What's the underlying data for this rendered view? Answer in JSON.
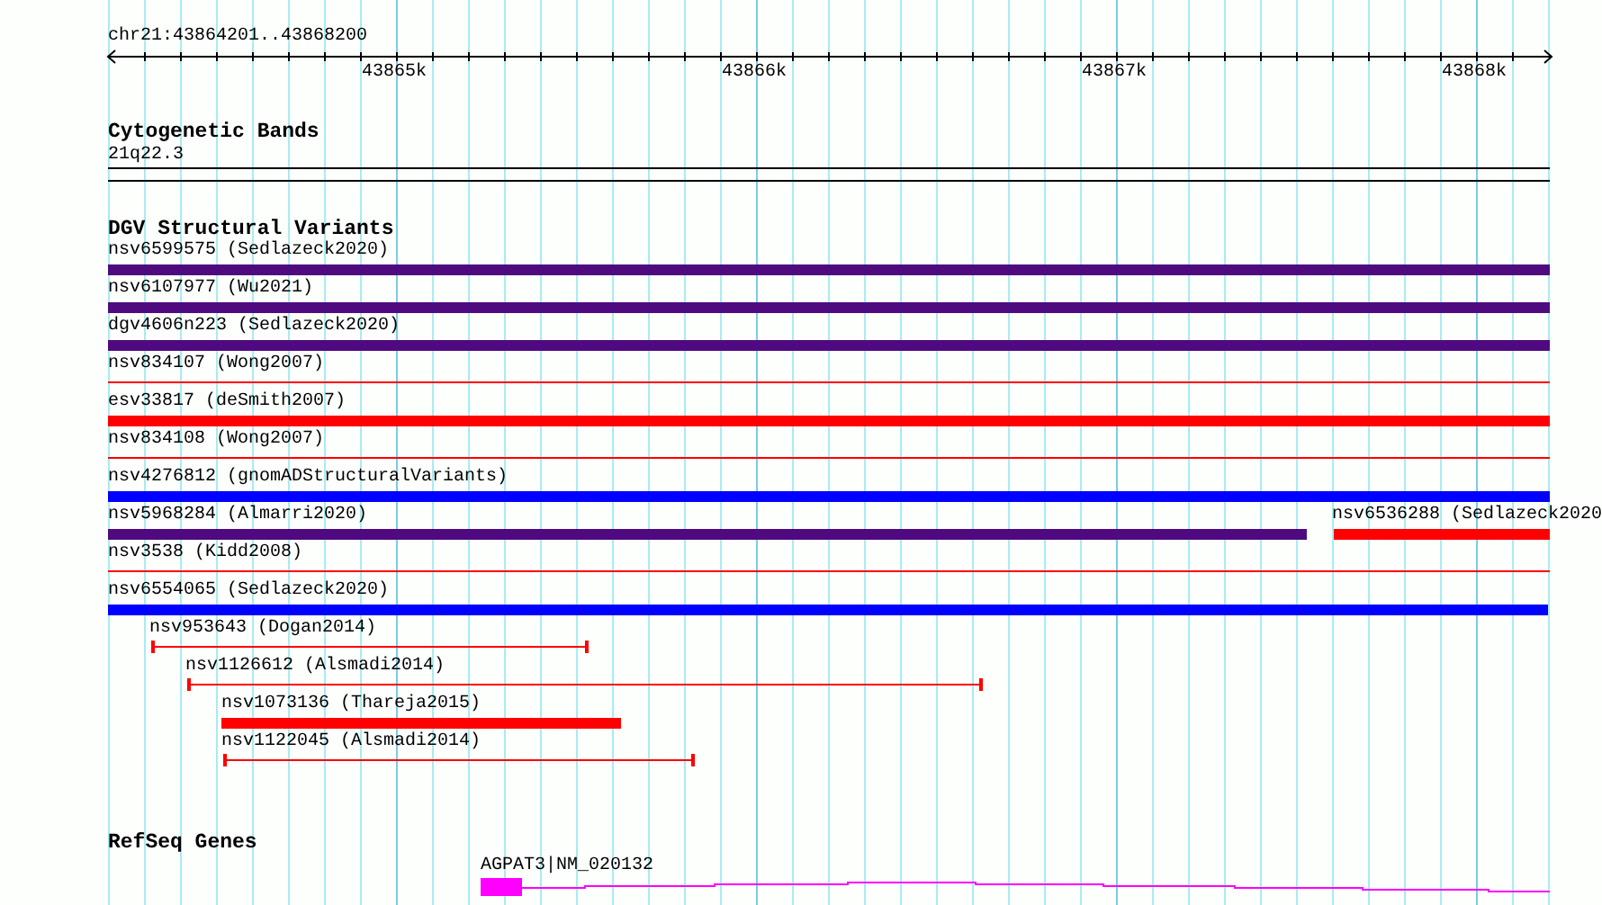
{
  "ruler": {
    "location": "chr21:43864201..43868200",
    "ticks": [
      "43865k",
      "43866k",
      "43867k",
      "43868k"
    ]
  },
  "cytoband_track": {
    "title": "Cytogenetic Bands",
    "band": "21q22.3"
  },
  "dgv_track": {
    "title": "DGV Structural Variants",
    "features": [
      {
        "label": "nsv6599575 (Sedlazeck2020)",
        "kind": "thick",
        "color": "#500a80"
      },
      {
        "label": "nsv6107977 (Wu2021)",
        "kind": "thick",
        "color": "#500a80"
      },
      {
        "label": "dgv4606n223 (Sedlazeck2020)",
        "kind": "thick",
        "color": "#500a80"
      },
      {
        "label": "nsv834107 (Wong2007)",
        "kind": "thin",
        "color": "#ff0000"
      },
      {
        "label": "esv33817 (deSmith2007)",
        "kind": "thick",
        "color": "#ff0000"
      },
      {
        "label": "nsv834108 (Wong2007)",
        "kind": "thin",
        "color": "#ff0000"
      },
      {
        "label": "nsv4276812 (gnomADStructuralVariants)",
        "kind": "thick",
        "color": "#0000ff"
      },
      {
        "label": "nsv5968284 (Almarri2020)",
        "kind": "thick",
        "color": "#500a80"
      },
      {
        "label": "nsv6536288 (Sedlazeck2020",
        "kind": "thick",
        "color": "#ff0000"
      },
      {
        "label": "nsv3538 (Kidd2008)",
        "kind": "thin",
        "color": "#ff0000"
      },
      {
        "label": "nsv6554065 (Sedlazeck2020)",
        "kind": "thick",
        "color": "#0000ff"
      },
      {
        "label": "nsv953643 (Dogan2014)",
        "kind": "capped",
        "color": "#ff0000"
      },
      {
        "label": "nsv1126612 (Alsmadi2014)",
        "kind": "capped",
        "color": "#ff0000"
      },
      {
        "label": "nsv1073136 (Thareja2015)",
        "kind": "thick",
        "color": "#ff0000"
      },
      {
        "label": "nsv1122045 (Alsmadi2014)",
        "kind": "capped",
        "color": "#ff0000"
      }
    ]
  },
  "refseq_track": {
    "title": "RefSeq Genes",
    "genes": [
      {
        "label": "AGPAT3|NM_020132"
      }
    ]
  }
}
